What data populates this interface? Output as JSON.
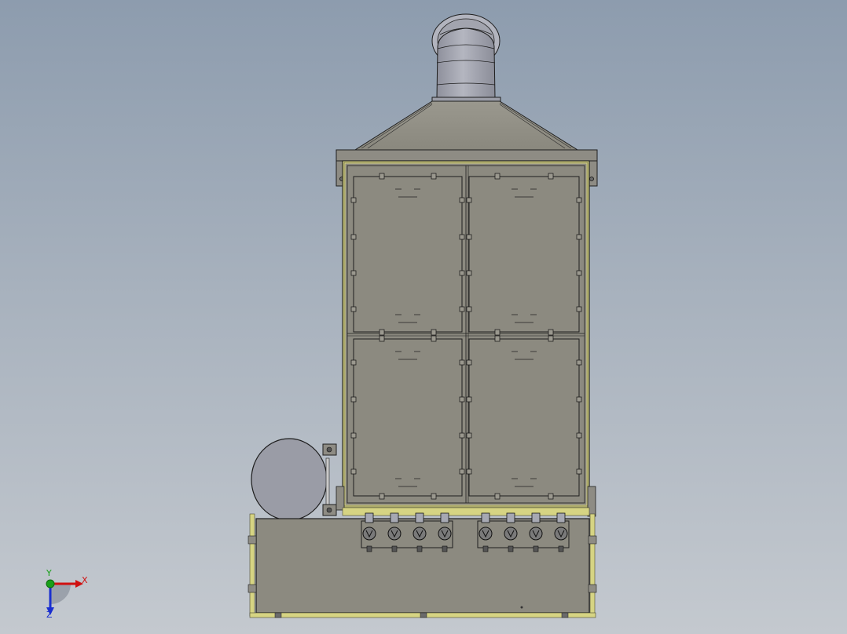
{
  "viewport": {
    "background_top": "#8d9cae",
    "background_bottom": "#c4c9cf"
  },
  "model": {
    "body_color": "#8c8a80",
    "frame_color": "#d6d483",
    "edge_color": "#1e1e1e",
    "duct_color": "#a6a8b2",
    "panel_count": 4,
    "valve_count": 8
  },
  "triad": {
    "x_label": "X",
    "y_label": "Y",
    "z_label": "Z",
    "x_color": "#d01010",
    "y_color": "#18a018",
    "z_color": "#1a2fd0"
  }
}
